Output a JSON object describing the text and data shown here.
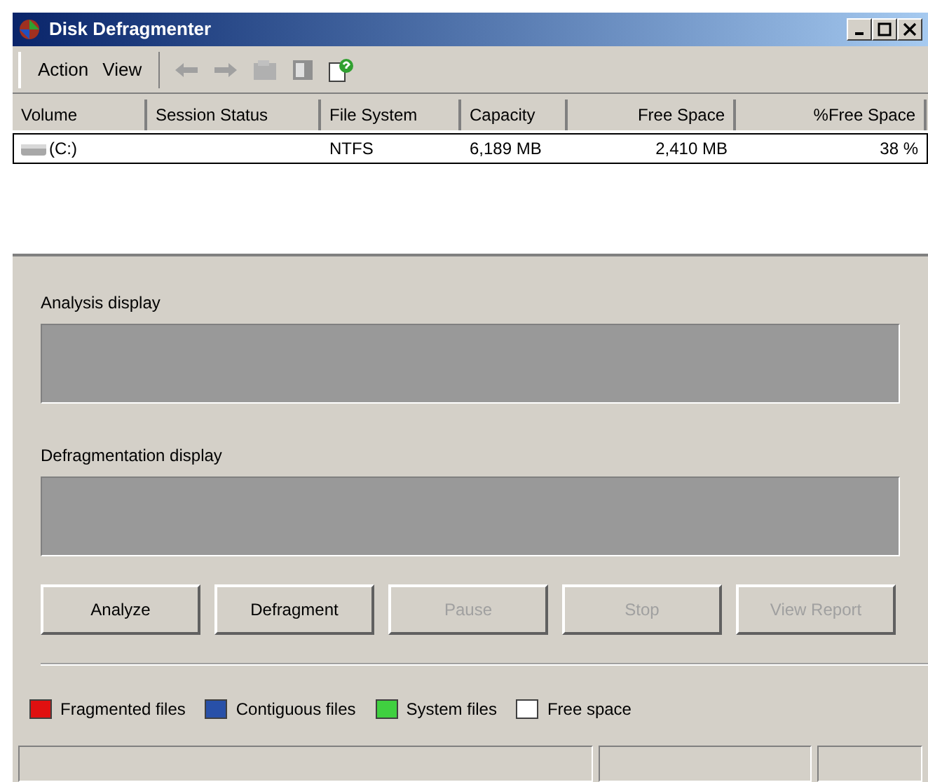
{
  "window": {
    "title": "Disk Defragmenter"
  },
  "menu": [
    {
      "label": "Action"
    },
    {
      "label": "View"
    }
  ],
  "table": {
    "columns": [
      "Volume",
      "Session Status",
      "File System",
      "Capacity",
      "Free Space",
      "%Free Space"
    ],
    "rows": [
      {
        "selected": true,
        "cells": [
          "(C:)",
          "",
          "NTFS",
          "6,189 MB",
          "2,410 MB",
          "38 %"
        ]
      }
    ]
  },
  "displays": [
    {
      "label": "Analysis display"
    },
    {
      "label": "Defragmentation display"
    }
  ],
  "buttons": [
    {
      "label": "Analyze",
      "disabled": false
    },
    {
      "label": "Defragment",
      "disabled": false
    },
    {
      "label": "Pause",
      "disabled": true
    },
    {
      "label": "Stop",
      "disabled": true
    },
    {
      "label": "View Report",
      "disabled": true
    }
  ],
  "legend": [
    {
      "label": "Fragmented files",
      "color": "#e01010"
    },
    {
      "label": "Contiguous files",
      "color": "#2850a8"
    },
    {
      "label": "System files",
      "color": "#40d040"
    },
    {
      "label": "Free space",
      "color": "#ffffff"
    }
  ]
}
